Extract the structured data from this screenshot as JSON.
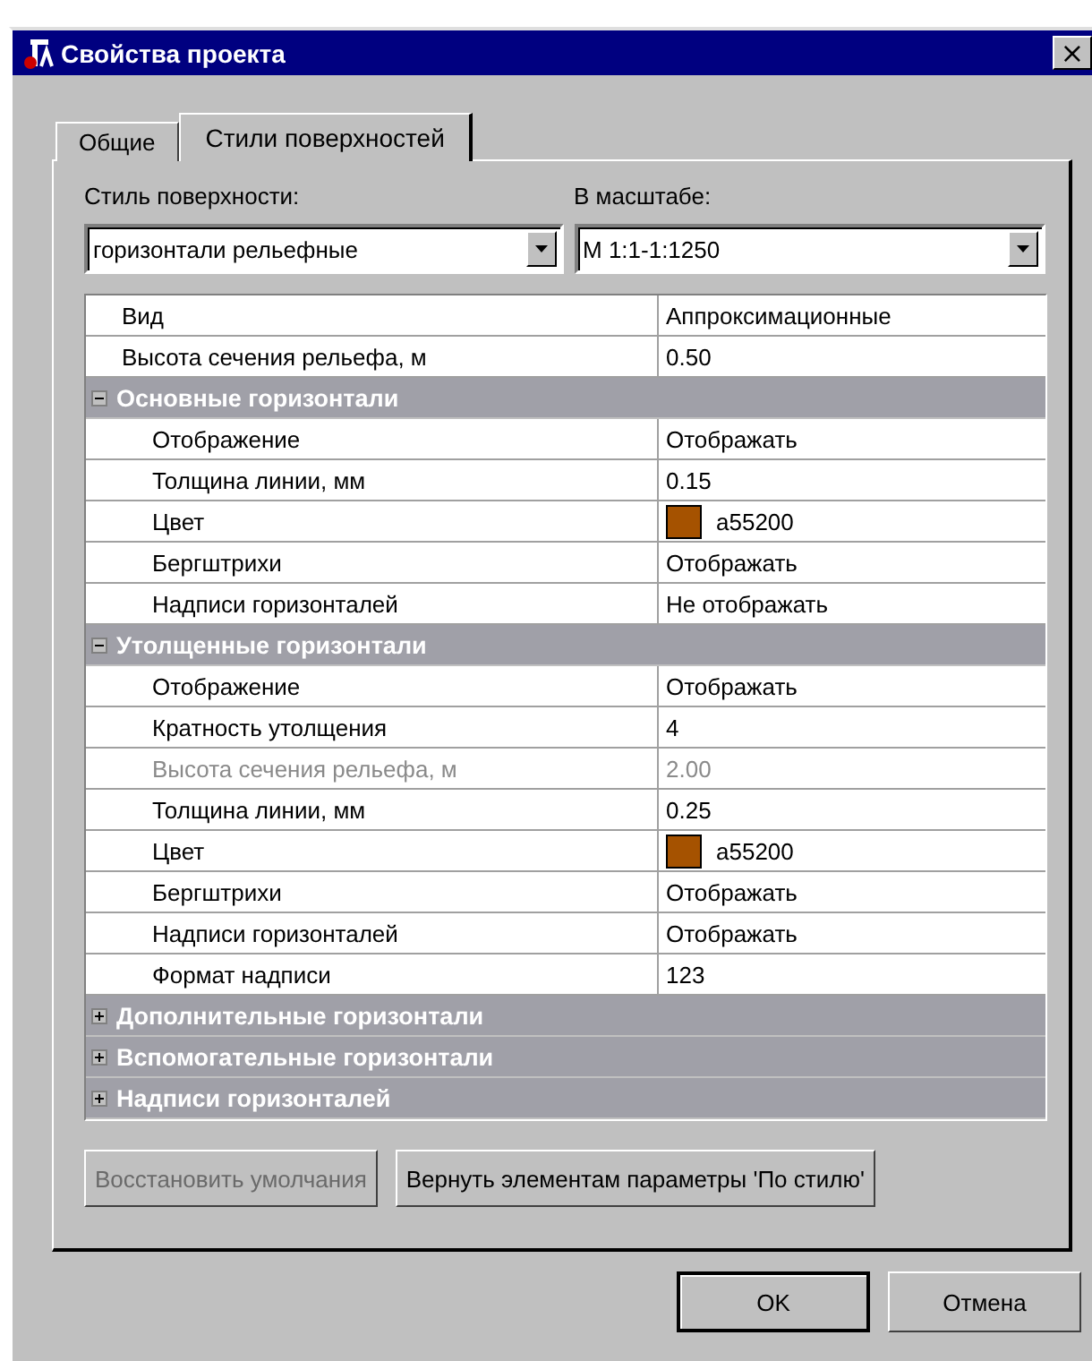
{
  "window": {
    "title": "Свойства проекта",
    "close": "×"
  },
  "tabs": [
    {
      "label": "Общие",
      "selected": false
    },
    {
      "label": "Стили поверхностей",
      "selected": true
    }
  ],
  "surface_style": {
    "label": "Стиль поверхности:",
    "value": "горизонтали рельефные"
  },
  "scale": {
    "label": "В масштабе:",
    "value": "М 1:1-1:1250"
  },
  "grid": [
    {
      "kind": "property",
      "name": "Вид",
      "value": "Аппроксимационные",
      "disabled": false
    },
    {
      "kind": "property",
      "name": "Высота сечения рельефа, м",
      "value": "0.50",
      "disabled": false
    },
    {
      "kind": "group",
      "name": "Основные горизонтали",
      "expanded": true,
      "children": [
        {
          "kind": "property",
          "name": "Отображение",
          "value": "Отображать",
          "disabled": false
        },
        {
          "kind": "property",
          "name": "Толщина линии, мм",
          "value": "0.15",
          "disabled": false
        },
        {
          "kind": "color",
          "name": "Цвет",
          "value": "a55200",
          "color": "#a55200",
          "disabled": false
        },
        {
          "kind": "property",
          "name": "Бергштрихи",
          "value": "Отображать",
          "disabled": false
        },
        {
          "kind": "property",
          "name": "Надписи горизонталей",
          "value": "Не отображать",
          "disabled": false
        }
      ]
    },
    {
      "kind": "group",
      "name": "Утолщенные горизонтали",
      "expanded": true,
      "children": [
        {
          "kind": "property",
          "name": "Отображение",
          "value": "Отображать",
          "disabled": false
        },
        {
          "kind": "property",
          "name": "Кратность утолщения",
          "value": "4",
          "disabled": false
        },
        {
          "kind": "property",
          "name": "Высота сечения рельефа, м",
          "value": "2.00",
          "disabled": true
        },
        {
          "kind": "property",
          "name": "Толщина линии, мм",
          "value": "0.25",
          "disabled": false
        },
        {
          "kind": "color",
          "name": "Цвет",
          "value": "a55200",
          "color": "#a55200",
          "disabled": false
        },
        {
          "kind": "property",
          "name": "Бергштрихи",
          "value": "Отображать",
          "disabled": false
        },
        {
          "kind": "property",
          "name": "Надписи горизонталей",
          "value": "Отображать",
          "disabled": false
        },
        {
          "kind": "property",
          "name": "Формат надписи",
          "value": "123",
          "disabled": false
        }
      ]
    },
    {
      "kind": "group",
      "name": "Дополнительные горизонтали",
      "expanded": false
    },
    {
      "kind": "group",
      "name": "Вспомогательные горизонтали",
      "expanded": false
    },
    {
      "kind": "group",
      "name": "Надписи горизонталей",
      "expanded": false
    }
  ],
  "panel_buttons": [
    {
      "label": "Восстановить умолчания",
      "disabled": true
    },
    {
      "label": "Вернуть элементам параметры 'По стилю'",
      "disabled": false
    }
  ],
  "buttons": [
    {
      "label": "OK",
      "default": true
    },
    {
      "label": "Отмена",
      "default": false
    }
  ]
}
